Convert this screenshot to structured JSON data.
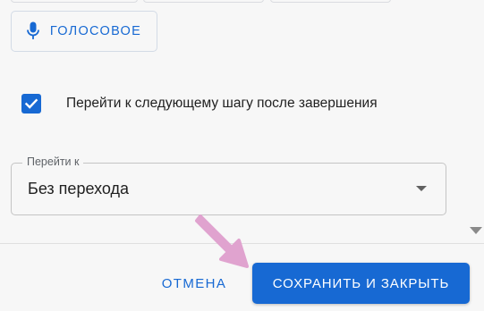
{
  "voice_button": {
    "label": "ГОЛОСОВОЕ",
    "icon": "microphone-icon"
  },
  "checkbox": {
    "checked": true,
    "label": "Перейти к следующему шагу после завершения"
  },
  "goto_select": {
    "legend": "Перейти к",
    "value": "Без перехода"
  },
  "footer": {
    "cancel_label": "ОТМЕНА",
    "save_label": "СОХРАНИТЬ И ЗАКРЫТЬ"
  },
  "colors": {
    "accent": "#1769d3",
    "pointer_arrow": "#e0a3cf"
  }
}
